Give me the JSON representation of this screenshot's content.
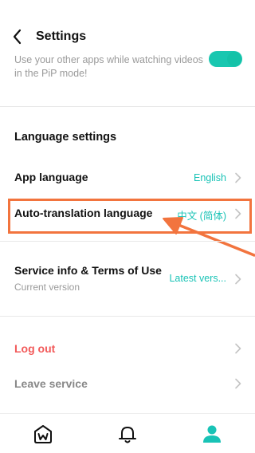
{
  "header": {
    "title": "Settings"
  },
  "pip": {
    "description": "Use your other apps while watching videos in the PiP mode!",
    "enabled": true
  },
  "language_section": {
    "title": "Language settings"
  },
  "rows": {
    "app_language": {
      "label": "App language",
      "value": "English"
    },
    "auto_translation": {
      "label": "Auto-translation language",
      "value": "中文 (简体)"
    },
    "service_info": {
      "label": "Service info & Terms of Use",
      "sub": "Current version",
      "value": "Latest vers..."
    },
    "logout": {
      "label": "Log out"
    },
    "leave": {
      "label": "Leave service"
    }
  },
  "colors": {
    "accent": "#19c3b6",
    "danger": "#f25a5a",
    "annotation": "#f2743e"
  },
  "nav": {
    "items": [
      "home-w-icon",
      "bell-icon",
      "profile-icon"
    ],
    "active": "profile-icon"
  }
}
